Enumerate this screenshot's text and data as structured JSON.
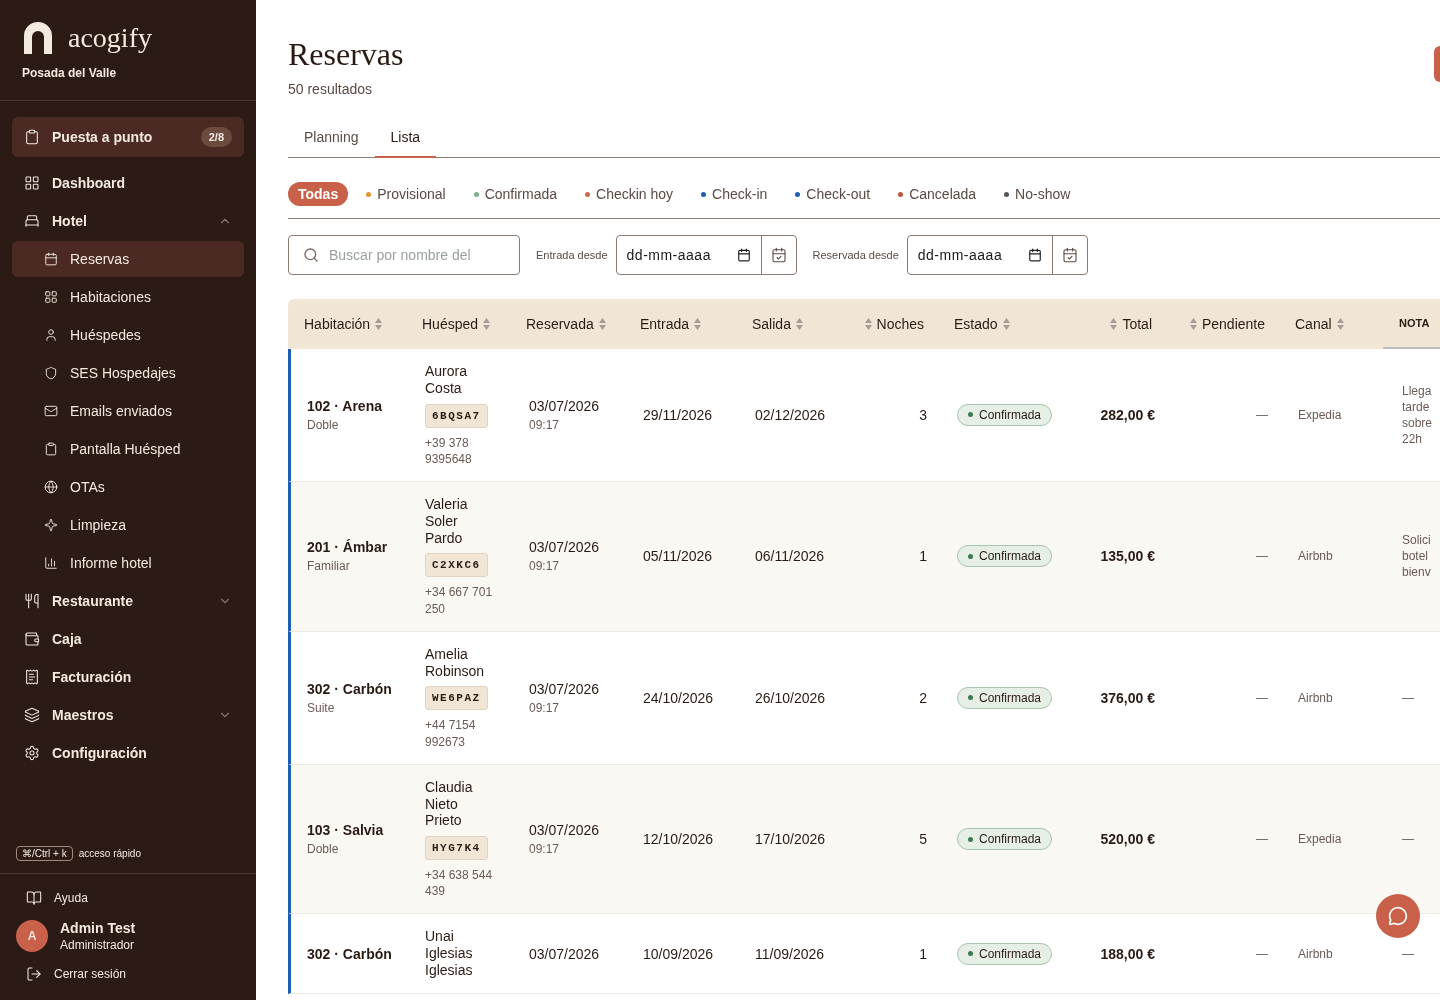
{
  "brand": {
    "name": "acogify",
    "property": "Posada del Valle"
  },
  "setup": {
    "label": "Puesta a punto",
    "badge": "2/8"
  },
  "nav": [
    {
      "label": "Dashboard",
      "selected": false
    },
    {
      "label": "Hotel",
      "selected": false,
      "expanded": true,
      "children": [
        {
          "label": "Reservas",
          "selected": true
        },
        {
          "label": "Habitaciones",
          "selected": false
        },
        {
          "label": "Huéspedes",
          "selected": false
        },
        {
          "label": "SES Hospedajes",
          "selected": false
        },
        {
          "label": "Emails enviados",
          "selected": false
        },
        {
          "label": "Pantalla Huésped",
          "selected": false
        },
        {
          "label": "OTAs",
          "selected": false
        },
        {
          "label": "Limpieza",
          "selected": false
        },
        {
          "label": "Informe hotel",
          "selected": false
        }
      ]
    },
    {
      "label": "Restaurante",
      "selected": false,
      "expanded": false
    },
    {
      "label": "Caja",
      "selected": false
    },
    {
      "label": "Facturación",
      "selected": false
    },
    {
      "label": "Maestros",
      "selected": false,
      "expanded": false
    },
    {
      "label": "Configuración",
      "selected": false
    }
  ],
  "shortcut": {
    "keys": "⌘/Ctrl + k",
    "label": "acceso rápido"
  },
  "help": "Ayuda",
  "user": {
    "initial": "A",
    "name": "Admin Test",
    "role": "Administrador"
  },
  "logout": "Cerrar sesión",
  "page": {
    "title": "Reservas",
    "subtitle": "50 resultados"
  },
  "tabs": [
    {
      "label": "Planning",
      "selected": false
    },
    {
      "label": "Lista",
      "selected": true
    }
  ],
  "status_filters": [
    {
      "label": "Todas",
      "selected": true
    },
    {
      "label": "Provisional",
      "selected": false,
      "color": "#e0962a"
    },
    {
      "label": "Confirmada",
      "selected": false,
      "color": "#7fae8c"
    },
    {
      "label": "Checkin hoy",
      "selected": false,
      "color": "#cc6a50"
    },
    {
      "label": "Check-in",
      "selected": false,
      "color": "#1a5fb4"
    },
    {
      "label": "Check-out",
      "selected": false,
      "color": "#1a5fb4"
    },
    {
      "label": "Cancelada",
      "selected": false,
      "color": "#c0533a"
    },
    {
      "label": "No-show",
      "selected": false,
      "color": "#555555"
    }
  ],
  "search": {
    "placeholder": "Buscar por nombre del"
  },
  "date_filters": [
    {
      "label": "Entrada desde",
      "placeholder": "dd-mm-aaaa"
    },
    {
      "label": "Reservada desde",
      "placeholder": "dd-mm-aaaa"
    }
  ],
  "table": {
    "columns": [
      "Habitación",
      "Huésped",
      "Reservada",
      "Entrada",
      "Salida",
      "Noches",
      "Estado",
      "Total",
      "Pendiente",
      "Canal",
      "NOTA"
    ],
    "rows": [
      {
        "room": "102 · Arena",
        "type": "Doble",
        "guest": "Aurora Costa",
        "code": "6BQSA7",
        "phone": "+39 378 9395648",
        "reserved": "03/07/2026",
        "reserved_time": "09:17",
        "checkin": "29/11/2026",
        "checkout": "02/12/2026",
        "nights": "3",
        "status": {
          "label": "Confirmada",
          "color": "#3d7a4d"
        },
        "total": "282,00 €",
        "pending": "—",
        "channel": "Expedia",
        "note": "Llega tarde sobre 22h"
      },
      {
        "room": "201 · Ámbar",
        "type": "Familiar",
        "guest": "Valeria Soler Pardo",
        "code": "C2XKC6",
        "phone": "+34 667 701 250",
        "reserved": "03/07/2026",
        "reserved_time": "09:17",
        "checkin": "05/11/2026",
        "checkout": "06/11/2026",
        "nights": "1",
        "status": {
          "label": "Confirmada",
          "color": "#3d7a4d"
        },
        "total": "135,00 €",
        "pending": "—",
        "channel": "Airbnb",
        "note": "Solici botel bienv"
      },
      {
        "room": "302 · Carbón",
        "type": "Suite",
        "guest": "Amelia Robinson",
        "code": "WE6PAZ",
        "phone": "+44 7154 992673",
        "reserved": "03/07/2026",
        "reserved_time": "09:17",
        "checkin": "24/10/2026",
        "checkout": "26/10/2026",
        "nights": "2",
        "status": {
          "label": "Confirmada",
          "color": "#3d7a4d"
        },
        "total": "376,00 €",
        "pending": "—",
        "channel": "Airbnb",
        "note": "—"
      },
      {
        "room": "103 · Salvia",
        "type": "Doble",
        "guest": "Claudia Nieto Prieto",
        "code": "HYG7K4",
        "phone": "+34 638 544 439",
        "reserved": "03/07/2026",
        "reserved_time": "09:17",
        "checkin": "12/10/2026",
        "checkout": "17/10/2026",
        "nights": "5",
        "status": {
          "label": "Confirmada",
          "color": "#3d7a4d"
        },
        "total": "520,00 €",
        "pending": "—",
        "channel": "Expedia",
        "note": "—"
      },
      {
        "room": "302 · Carbón",
        "guest": "Unai Iglesias Iglesias",
        "reserved": "03/07/2026",
        "checkin": "10/09/2026",
        "checkout": "11/09/2026",
        "nights": "1",
        "status": {
          "label": "Confirmada",
          "color": "#3d7a4d"
        },
        "total": "188,00 €",
        "pending": "—",
        "channel": "Airbnb",
        "note": "—"
      }
    ]
  }
}
